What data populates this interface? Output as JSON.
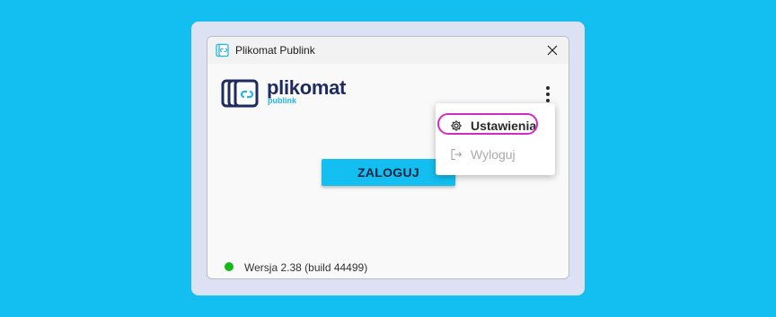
{
  "window": {
    "title": "Plikomat Publink",
    "icons": {
      "app": "app-logo-icon",
      "close": "close-icon"
    }
  },
  "logo": {
    "name": "plikomat",
    "subtitle": "publink",
    "icon": "plikomat-logo-icon"
  },
  "main": {
    "login_label": "ZALOGUJ",
    "more_icon": "more-vert-icon"
  },
  "menu": {
    "items": [
      {
        "label": "Ustawienia",
        "icon": "gear-icon",
        "enabled": true,
        "highlighted": true
      },
      {
        "label": "Wyloguj",
        "icon": "logout-icon",
        "enabled": false
      }
    ]
  },
  "status": {
    "version": "Wersja 2.38 (build 44499)",
    "indicator_color": "#14b81b"
  },
  "colors": {
    "accent": "#12bff0",
    "brand_dark": "#1f2a5e",
    "highlight": "#d32ac4"
  }
}
